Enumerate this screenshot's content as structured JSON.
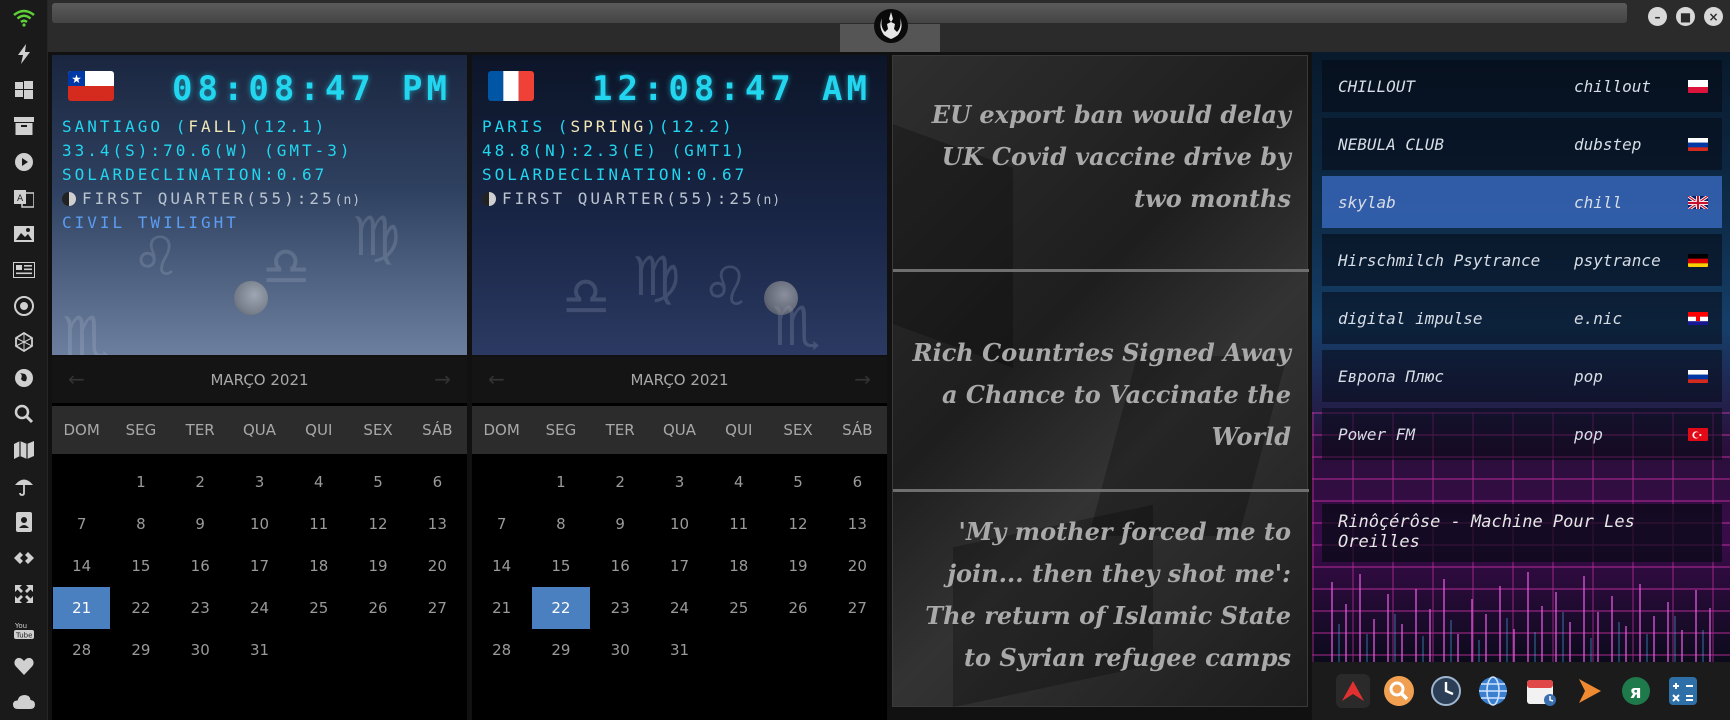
{
  "clocks": [
    {
      "time": "08:08:47",
      "ampm": "PM",
      "city_prefix": "SANTIAGO (",
      "season": "FALL",
      "city_suffix": ")(12.1)",
      "coords": "33.4(S):70.6(W) (GMT-3)",
      "solar": "SOLARDECLINATION:0.67",
      "moon": "FIRST QUARTER(55):25",
      "moon_unit": "(n)",
      "twilight": "CIVIL TWILIGHT",
      "flag": "chile"
    },
    {
      "time": "12:08:47",
      "ampm": "AM",
      "city_prefix": "PARIS (",
      "season": "SPRING",
      "city_suffix": ")(12.2)",
      "coords": "48.8(N):2.3(E) (GMT1)",
      "solar": "SOLARDECLINATION:0.67",
      "moon": "FIRST QUARTER(55):25",
      "moon_unit": "(n)",
      "flag": "france"
    }
  ],
  "calendars": [
    {
      "month": "MARÇO 2021",
      "weekdays": [
        "DOM",
        "SEG",
        "TER",
        "QUA",
        "QUI",
        "SEX",
        "SÁB"
      ],
      "lead_blanks": 1,
      "days": 31,
      "selected": 21
    },
    {
      "month": "MARÇO 2021",
      "weekdays": [
        "DOM",
        "SEG",
        "TER",
        "QUA",
        "QUI",
        "SEX",
        "SÁB"
      ],
      "lead_blanks": 1,
      "days": 31,
      "selected": 22
    }
  ],
  "news": [
    "EU export ban would delay UK Covid vaccine drive by two months",
    "Rich Countries Signed Away a Chance to Vaccinate the World",
    "'My mother forced me to join... then they shot me': The return of Islamic State to Syrian refugee camps"
  ],
  "radio": {
    "stations": [
      {
        "name": "CHILLOUT",
        "genre": "chillout",
        "flag": "poland"
      },
      {
        "name": "NEBULA CLUB",
        "genre": "dubstep",
        "flag": "russia"
      },
      {
        "name": "skylab",
        "genre": "chill",
        "flag": "uk"
      },
      {
        "name": "Hirschmilch Psytrance",
        "genre": "psytrance",
        "flag": "germany"
      },
      {
        "name": "digital impulse",
        "genre": "e.nic",
        "flag": "croatia"
      },
      {
        "name": "Европа Плюс",
        "genre": "pop",
        "flag": "russia"
      },
      {
        "name": "Power FM",
        "genre": "pop",
        "flag": "turkey"
      }
    ],
    "selected_index": 2,
    "now_playing": "Rinôçérôse - Machine Pour Les Oreilles"
  },
  "colors": {
    "digital_cyan": "#22d6f0",
    "calendar_highlight": "#4a7fc0",
    "wifi_green": "#5fcf3a"
  },
  "sidebar_icons": [
    "wifi-icon",
    "lightning-icon",
    "windows-icon",
    "archive-icon",
    "play-icon",
    "translate-icon",
    "image-icon",
    "news-icon",
    "settings-icon",
    "network-icon",
    "globe-icon",
    "search-icon",
    "map-icon",
    "umbrella-icon",
    "contacts-icon",
    "link-icon",
    "fullscreen-icon",
    "youtube-icon",
    "heart-icon",
    "cloud-icon"
  ],
  "dock_apps": [
    "artix-icon",
    "search-app-icon",
    "clock-app-icon",
    "browser-icon",
    "calendar-icon",
    "arrow-app-icon",
    "yandex-icon",
    "calculator-icon"
  ]
}
